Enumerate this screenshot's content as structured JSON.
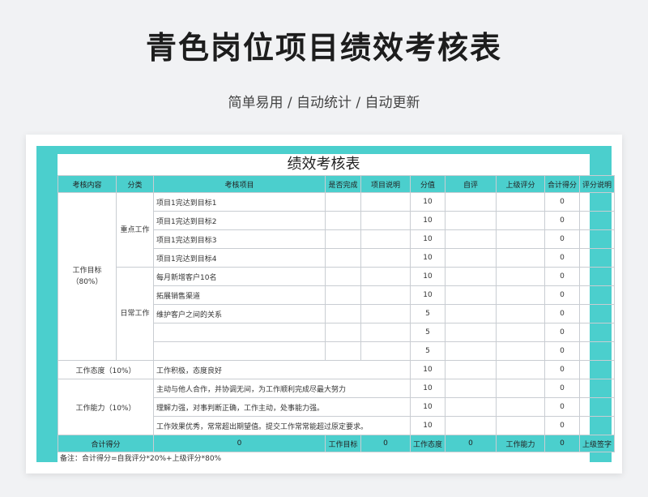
{
  "page": {
    "title": "青色岗位项目绩效考核表",
    "subtitle": "简单易用 / 自动统计 / 自动更新"
  },
  "sheet": {
    "title": "绩效考核表",
    "headers": [
      "考核内容",
      "分类",
      "考核项目",
      "是否完成",
      "项目说明",
      "分值",
      "自评",
      "上级评分",
      "合计得分",
      "评分说明"
    ],
    "group_work_goal": "工作目标（80%）",
    "cat_key": "重点工作",
    "cat_daily": "日常工作",
    "group_attitude": "工作态度（10%）",
    "group_ability": "工作能力（10%）",
    "rows": [
      {
        "item": "项目1完达到目标1",
        "score": "10",
        "total": "0"
      },
      {
        "item": "项目1完达到目标2",
        "score": "10",
        "total": "0"
      },
      {
        "item": "项目1完达到目标3",
        "score": "10",
        "total": "0"
      },
      {
        "item": "项目1完达到目标4",
        "score": "10",
        "total": "0"
      },
      {
        "item": "每月新增客户10名",
        "score": "10",
        "total": "0"
      },
      {
        "item": "拓展销售渠道",
        "score": "10",
        "total": "0"
      },
      {
        "item": "维护客户之间的关系",
        "score": "5",
        "total": "0"
      },
      {
        "item": "",
        "score": "5",
        "total": "0"
      },
      {
        "item": "",
        "score": "5",
        "total": "0"
      },
      {
        "item": "工作积极，态度良好",
        "score": "10",
        "total": "0"
      },
      {
        "item": "主动与他人合作，并协调无间，为工作顺利完成尽最大努力",
        "score": "10",
        "total": "0"
      },
      {
        "item": "理解力强，对事判断正确，工作主动，处事能力强。",
        "score": "10",
        "total": "0"
      },
      {
        "item": "工作效果优秀，常常超出期望值。提交工作常常能超过原定要求。",
        "score": "10",
        "total": "0"
      }
    ],
    "totals": {
      "total_label": "合计得分",
      "total_value": "0",
      "goal_label": "工作目标",
      "goal_value": "0",
      "attitude_label": "工作态度",
      "attitude_value": "0",
      "ability_label": "工作能力",
      "ability_value": "0",
      "signature_label": "上级签字"
    },
    "note": "备注：合计得分=自我评分*20%+上级评分*80%"
  },
  "colors": {
    "accent": "#4bcfcd",
    "background": "#f1f2f4"
  }
}
